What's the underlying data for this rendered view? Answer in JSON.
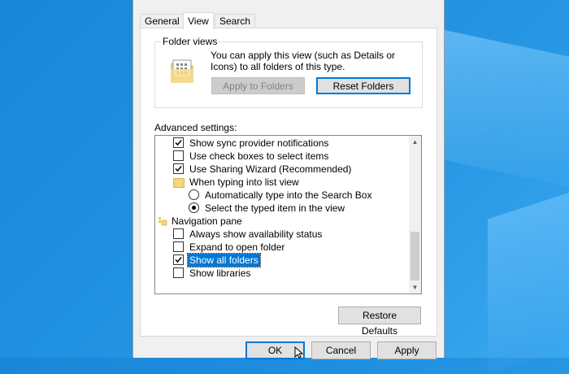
{
  "tabs": [
    {
      "label": "General"
    },
    {
      "label": "View"
    },
    {
      "label": "Search"
    }
  ],
  "folder_views": {
    "title": "Folder views",
    "description": "You can apply this view (such as Details or Icons) to all folders of this type.",
    "apply_label": "Apply to Folders",
    "reset_label": "Reset Folders"
  },
  "advanced": {
    "label": "Advanced settings:",
    "items": [
      {
        "type": "checkbox",
        "label": "Show sync provider notifications",
        "checked": true
      },
      {
        "type": "checkbox",
        "label": "Use check boxes to select items",
        "checked": false
      },
      {
        "type": "checkbox",
        "label": "Use Sharing Wizard (Recommended)",
        "checked": true
      },
      {
        "type": "folder",
        "label": "When typing into list view"
      },
      {
        "type": "radio",
        "label": "Automatically type into the Search Box",
        "checked": false
      },
      {
        "type": "radio",
        "label": "Select the typed item in the view",
        "checked": true
      },
      {
        "type": "nav",
        "label": "Navigation pane"
      },
      {
        "type": "checkbox",
        "label": "Always show availability status",
        "checked": false
      },
      {
        "type": "checkbox",
        "label": "Expand to open folder",
        "checked": false
      },
      {
        "type": "checkbox",
        "label": "Show all folders",
        "checked": true,
        "selected": true
      },
      {
        "type": "checkbox",
        "label": "Show libraries",
        "checked": false
      }
    ]
  },
  "restore_label": "Restore Defaults",
  "footer": {
    "ok_label": "OK",
    "cancel_label": "Cancel",
    "apply_label": "Apply"
  },
  "colors": {
    "accent": "#0078d7",
    "desktop": "#1f8fe0"
  }
}
